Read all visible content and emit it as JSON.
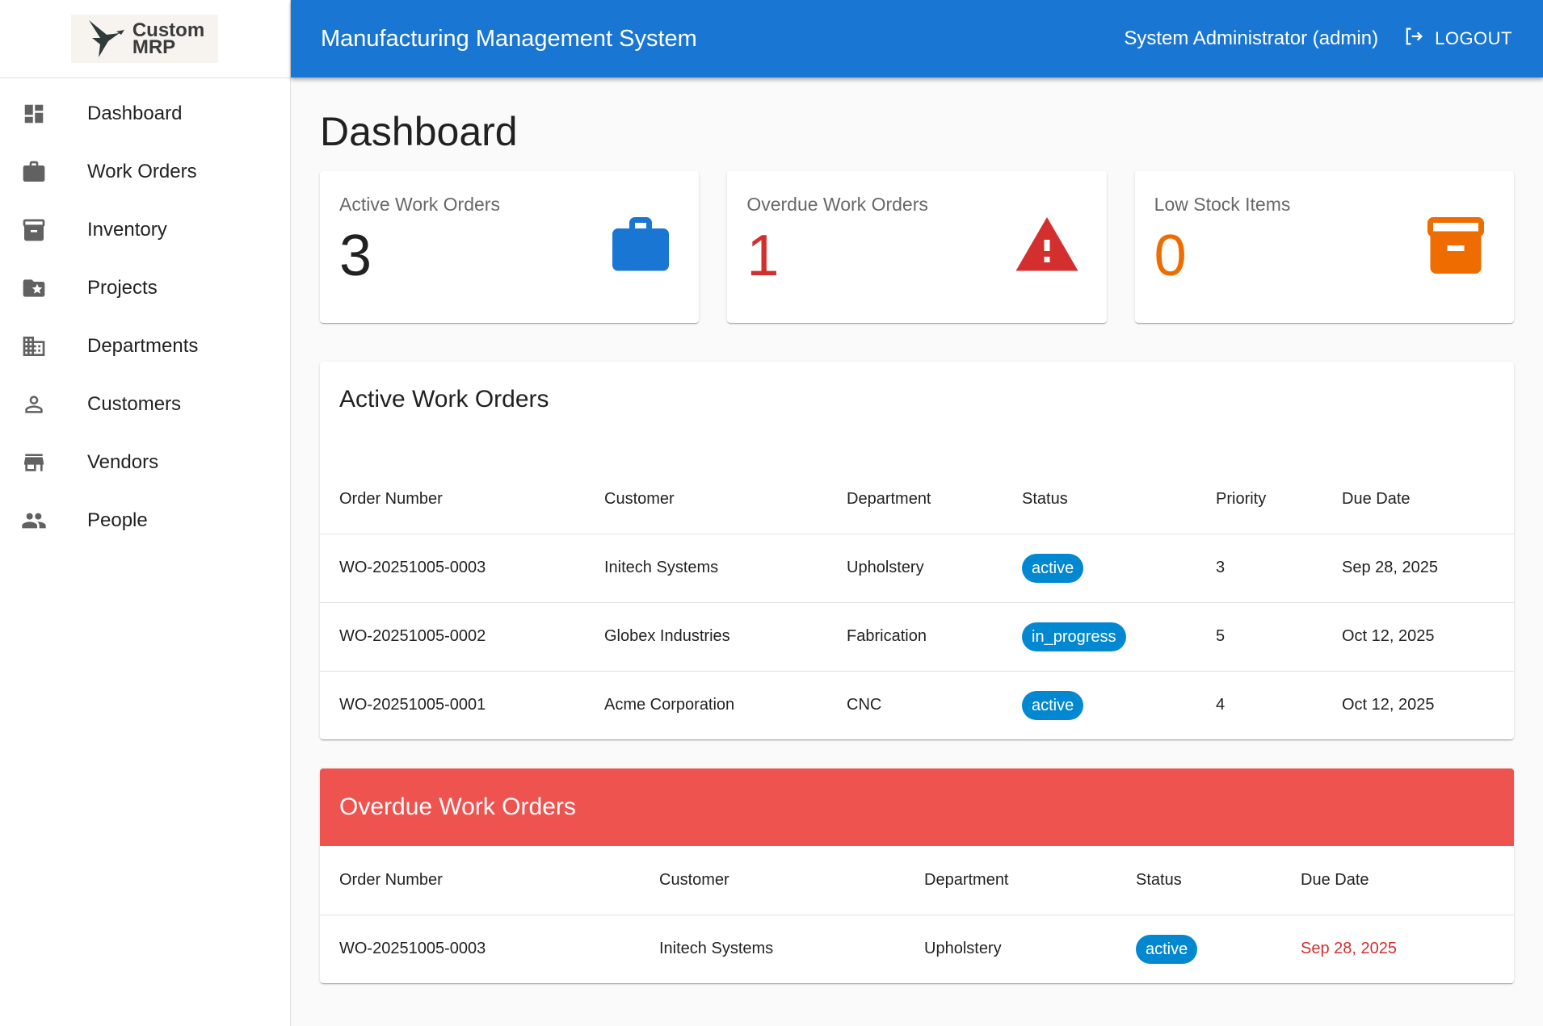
{
  "logo": {
    "line1": "Custom",
    "line2": "MRP"
  },
  "sidebar": {
    "items": [
      {
        "label": "Dashboard",
        "icon": "dashboard-icon"
      },
      {
        "label": "Work Orders",
        "icon": "briefcase-icon"
      },
      {
        "label": "Inventory",
        "icon": "archive-icon"
      },
      {
        "label": "Projects",
        "icon": "folder-star-icon"
      },
      {
        "label": "Departments",
        "icon": "building-icon"
      },
      {
        "label": "Customers",
        "icon": "person-icon"
      },
      {
        "label": "Vendors",
        "icon": "store-icon"
      },
      {
        "label": "People",
        "icon": "people-icon"
      }
    ]
  },
  "header": {
    "title": "Manufacturing Management System",
    "user": "System Administrator (admin)",
    "logout": "LOGOUT"
  },
  "page": {
    "title": "Dashboard"
  },
  "stats": [
    {
      "label": "Active Work Orders",
      "value": "3",
      "color": "#1976d2",
      "icon": "briefcase-icon"
    },
    {
      "label": "Overdue Work Orders",
      "value": "1",
      "color": "#d32f2f",
      "icon": "warning-icon"
    },
    {
      "label": "Low Stock Items",
      "value": "0",
      "color": "#ef6c00",
      "icon": "archive-icon"
    }
  ],
  "active_orders": {
    "title": "Active Work Orders",
    "columns": [
      "Order Number",
      "Customer",
      "Department",
      "Status",
      "Priority",
      "Due Date"
    ],
    "rows": [
      [
        "WO-20251005-0003",
        "Initech Systems",
        "Upholstery",
        "active",
        "3",
        "Sep 28, 2025"
      ],
      [
        "WO-20251005-0002",
        "Globex Industries",
        "Fabrication",
        "in_progress",
        "5",
        "Oct 12, 2025"
      ],
      [
        "WO-20251005-0001",
        "Acme Corporation",
        "CNC",
        "active",
        "4",
        "Oct 12, 2025"
      ]
    ]
  },
  "overdue_orders": {
    "title": "Overdue Work Orders",
    "columns": [
      "Order Number",
      "Customer",
      "Department",
      "Status",
      "Due Date"
    ],
    "rows": [
      [
        "WO-20251005-0003",
        "Initech Systems",
        "Upholstery",
        "active",
        "Sep 28, 2025"
      ]
    ]
  },
  "colors": {
    "primary": "#1976d2",
    "overdue_header": "#ef5350",
    "chip": "#0288d1"
  }
}
